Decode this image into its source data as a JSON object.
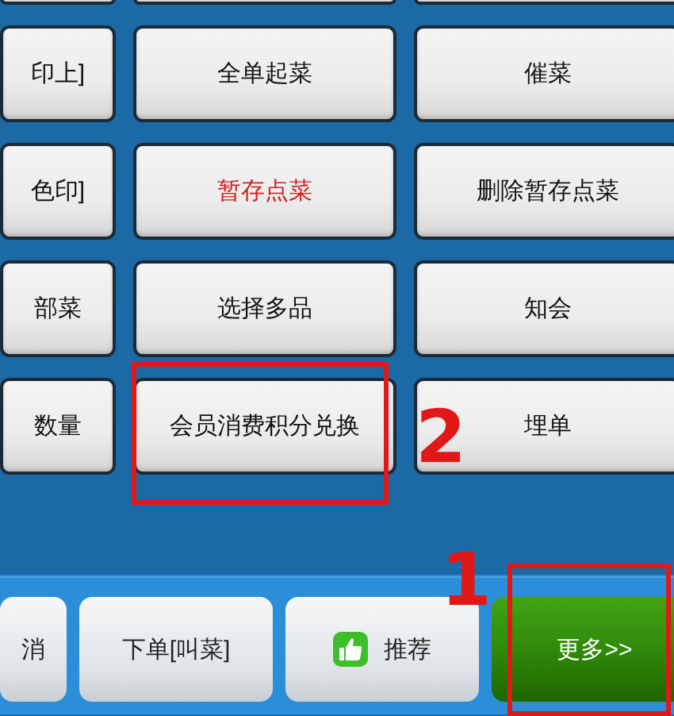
{
  "grid": [
    [
      {
        "label": "印上]",
        "highlighted": false
      },
      {
        "label": "全单起菜",
        "highlighted": false
      },
      {
        "label": "催菜",
        "highlighted": false
      }
    ],
    [
      {
        "label": "色印]",
        "highlighted": false
      },
      {
        "label": "暂存点菜",
        "highlighted": true
      },
      {
        "label": "删除暂存点菜",
        "highlighted": false
      }
    ],
    [
      {
        "label": "部菜",
        "highlighted": false
      },
      {
        "label": "选择多品",
        "highlighted": false
      },
      {
        "label": "知会",
        "highlighted": false
      }
    ],
    [
      {
        "label": "数量",
        "highlighted": false
      },
      {
        "label": "会员消费积分兑换",
        "highlighted": false
      },
      {
        "label": "埋单",
        "highlighted": false
      }
    ]
  ],
  "bottom_bar": [
    {
      "label": "消",
      "kind": "plain"
    },
    {
      "label": "下单[叫菜]",
      "kind": "plain"
    },
    {
      "label": "推荐",
      "kind": "icon"
    },
    {
      "label": "更多>>",
      "kind": "primary"
    }
  ],
  "annotations": [
    {
      "kind": "box"
    },
    {
      "kind": "box"
    },
    {
      "kind": "number",
      "label": "2"
    },
    {
      "kind": "number",
      "label": "1"
    }
  ]
}
